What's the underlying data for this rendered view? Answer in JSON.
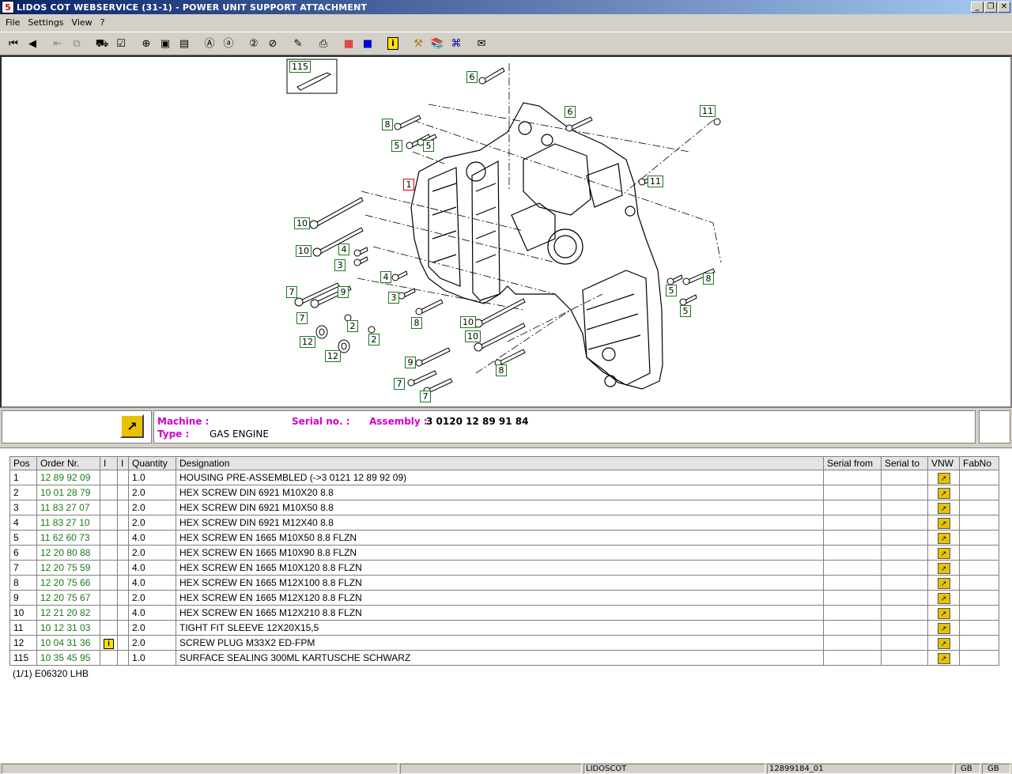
{
  "window": {
    "icon": "5",
    "title": "LIDOS COT WEBSERVICE (31-1) - POWER UNIT SUPPORT ATTACHMENT",
    "minimize_icon": "_",
    "restore_icon": "❐",
    "close_icon": "✕"
  },
  "menu": [
    "File",
    "Settings",
    "View",
    "?"
  ],
  "toolbar_icons": [
    "first-page-icon",
    "previous-page-icon",
    "export-icon",
    "copy-icon",
    "cart-icon",
    "checklist-icon",
    "zoom-in-icon",
    "page-fit-icon",
    "page-icon",
    "annotate-icon",
    "annotate-edit-icon",
    "help-2-icon",
    "help-search-icon",
    "edit-icon",
    "print-icon",
    "grid-red-icon",
    "grid-blue-icon",
    "info-icon",
    "tools-icon",
    "books-icon",
    "lidos-icon",
    "mail-icon"
  ],
  "drawing": {
    "inset_label": "115",
    "callouts": [
      {
        "num": "6"
      },
      {
        "num": "6"
      },
      {
        "num": "11"
      },
      {
        "num": "8"
      },
      {
        "num": "5"
      },
      {
        "num": "5"
      },
      {
        "num": "1",
        "red": true
      },
      {
        "num": "11"
      },
      {
        "num": "10"
      },
      {
        "num": "10"
      },
      {
        "num": "4"
      },
      {
        "num": "3"
      },
      {
        "num": "4"
      },
      {
        "num": "8"
      },
      {
        "num": "5"
      },
      {
        "num": "7"
      },
      {
        "num": "9"
      },
      {
        "num": "3"
      },
      {
        "num": "5"
      },
      {
        "num": "7"
      },
      {
        "num": "2"
      },
      {
        "num": "8"
      },
      {
        "num": "10"
      },
      {
        "num": "10"
      },
      {
        "num": "12"
      },
      {
        "num": "2"
      },
      {
        "num": "12"
      },
      {
        "num": "9"
      },
      {
        "num": "8"
      },
      {
        "num": "7"
      },
      {
        "num": "7"
      }
    ]
  },
  "info": {
    "machine_label": "Machine :",
    "machine_value": "",
    "serial_label": "Serial no. :",
    "serial_value": "",
    "assembly_label": "Assembly :",
    "assembly_value": "3 0120 12 89 91 84",
    "type_label": "Type :",
    "type_value": "GAS ENGINE"
  },
  "table": {
    "headers": [
      "Pos",
      "Order Nr.",
      "I",
      "I",
      "Quantity",
      "Designation",
      "Serial from",
      "Serial to",
      "VNW",
      "FabNo"
    ],
    "rows": [
      {
        "pos": "1",
        "order": "12 89 92 09",
        "info": false,
        "qty": "1.0",
        "designation": "HOUSING PRE-ASSEMBLED (->3 0121 12 89 92 09)"
      },
      {
        "pos": "2",
        "order": "10 01 28 79",
        "info": false,
        "qty": "2.0",
        "designation": "HEX SCREW DIN 6921 M10X20 8.8"
      },
      {
        "pos": "3",
        "order": "11 83 27 07",
        "info": false,
        "qty": "2.0",
        "designation": "HEX SCREW DIN 6921 M10X50 8.8"
      },
      {
        "pos": "4",
        "order": "11 83 27 10",
        "info": false,
        "qty": "2.0",
        "designation": "HEX SCREW DIN 6921 M12X40 8.8"
      },
      {
        "pos": "5",
        "order": "11 62 60 73",
        "info": false,
        "qty": "4.0",
        "designation": "HEX SCREW EN 1665 M10X50 8.8 FLZN"
      },
      {
        "pos": "6",
        "order": "12 20 80 88",
        "info": false,
        "qty": "2.0",
        "designation": "HEX SCREW EN 1665 M10X90 8.8 FLZN"
      },
      {
        "pos": "7",
        "order": "12 20 75 59",
        "info": false,
        "qty": "4.0",
        "designation": "HEX SCREW EN 1665 M10X120 8.8 FLZN"
      },
      {
        "pos": "8",
        "order": "12 20 75 66",
        "info": false,
        "qty": "4.0",
        "designation": "HEX SCREW EN 1665 M12X100 8.8 FLZN"
      },
      {
        "pos": "9",
        "order": "12 20 75 67",
        "info": false,
        "qty": "2.0",
        "designation": "HEX SCREW EN 1665 M12X120 8.8 FLZN"
      },
      {
        "pos": "10",
        "order": "12 21 20 82",
        "info": false,
        "qty": "4.0",
        "designation": "HEX SCREW EN 1665 M12X210 8.8 FLZN"
      },
      {
        "pos": "11",
        "order": "10 12 31 03",
        "info": false,
        "qty": "2.0",
        "designation": "TIGHT FIT SLEEVE 12X20X15,5"
      },
      {
        "pos": "12",
        "order": "10 04 31 36",
        "info": true,
        "qty": "2.0",
        "designation": "SCREW PLUG M33X2 ED-FPM"
      },
      {
        "pos": "115",
        "order": "10 35 45 95",
        "info": false,
        "qty": "1.0",
        "designation": "SURFACE SEALING 300ML KARTUSCHE SCHWARZ"
      }
    ],
    "info_glyph": "i",
    "vnw_glyph": "↗",
    "footnote": "(1/1) E06320 LHB"
  },
  "status": {
    "app": "LIDOSCOT",
    "doc": "12899184_01",
    "lang1": "GB",
    "lang2": "GB"
  },
  "colors": {
    "title_start": "#0a246a",
    "title_end": "#a6caf0",
    "label_magenta": "#d000c8",
    "order_green": "#1a7a1a",
    "callout_red": "#dd0000"
  }
}
